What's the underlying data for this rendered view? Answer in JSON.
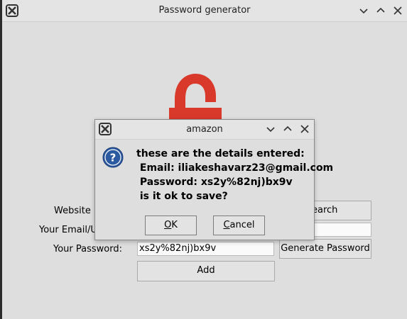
{
  "window": {
    "title": "Password generator"
  },
  "form": {
    "website_label": "Website N",
    "email_label": "Your Email/Us",
    "password_label": "Your Password:",
    "password_value": "xs2y%82nj)bx9v",
    "search_label": "earch",
    "generate_label": "Generate Password",
    "add_label": "Add"
  },
  "dialog": {
    "title": "amazon",
    "message": "these are the details entered:\n Email: iliakeshavarz23@gmail.com\n Password: xs2y%82nj)bx9v\n is it ok to save?",
    "ok_first": "O",
    "ok_rest": "K",
    "cancel_first": "C",
    "cancel_rest": "ancel"
  },
  "colors": {
    "lock_red": "#d8392b",
    "question_blue": "#2c5aa0"
  }
}
